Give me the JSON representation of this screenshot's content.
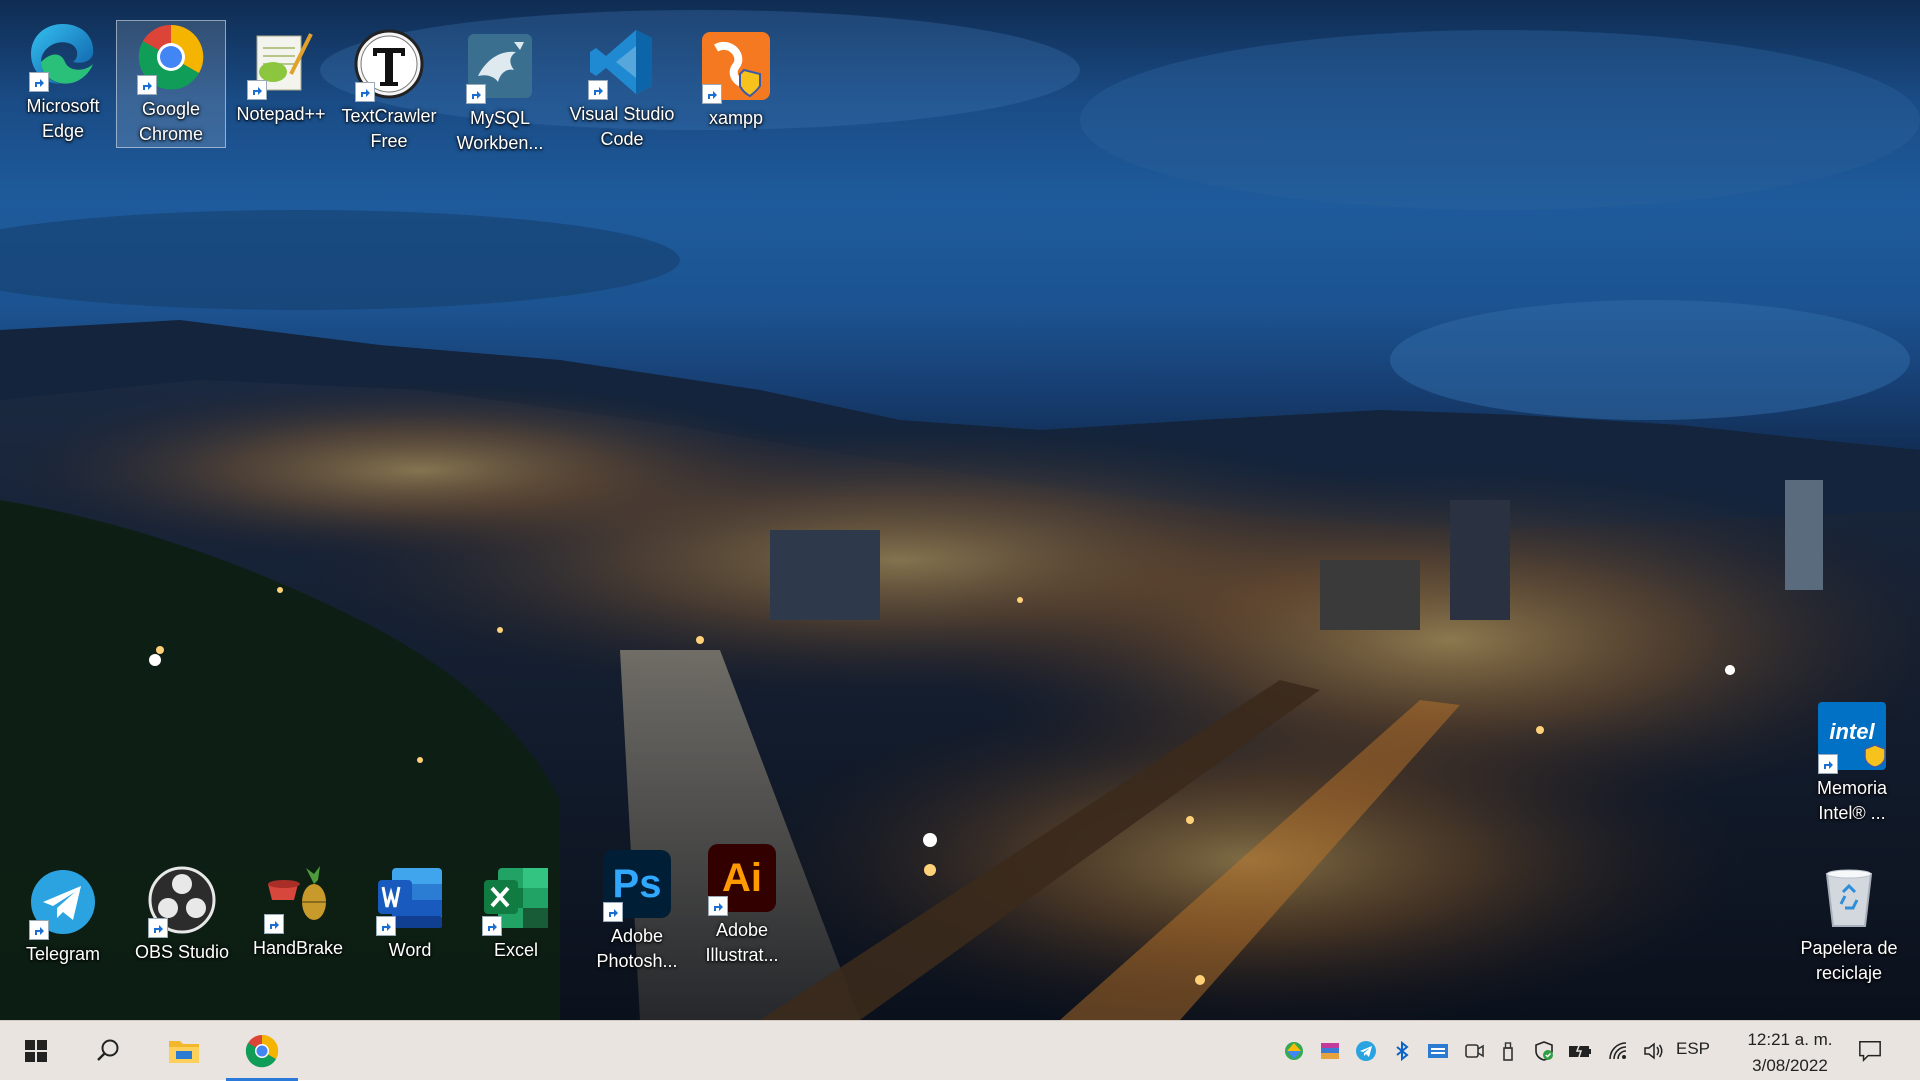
{
  "desktop": {
    "icons": [
      {
        "label": "Microsoft Edge",
        "icon": "edge-icon"
      },
      {
        "label": "Google Chrome",
        "icon": "chrome-icon",
        "selected": true
      },
      {
        "label": "Notepad++",
        "icon": "notepadpp-icon"
      },
      {
        "label": "TextCrawler Free",
        "icon": "textcrawler-icon"
      },
      {
        "label": "MySQL Workben...",
        "icon": "mysql-workbench-icon"
      },
      {
        "label": "Visual Studio Code",
        "icon": "vscode-icon"
      },
      {
        "label": "xampp",
        "icon": "xampp-icon"
      },
      {
        "label": "Telegram",
        "icon": "telegram-icon"
      },
      {
        "label": "OBS Studio",
        "icon": "obs-icon"
      },
      {
        "label": "HandBrake",
        "icon": "handbrake-icon"
      },
      {
        "label": "Word",
        "icon": "word-icon"
      },
      {
        "label": "Excel",
        "icon": "excel-icon"
      },
      {
        "label": "Adobe Photosh...",
        "icon": "photoshop-icon",
        "glyph_text": "Ps"
      },
      {
        "label": "Adobe Illustrat...",
        "icon": "illustrator-icon",
        "glyph_text": "Ai"
      },
      {
        "label": "Memoria Intel® ...",
        "icon": "intel-icon",
        "glyph_text": "intel"
      },
      {
        "label": "Papelera de reciclaje",
        "icon": "recycle-bin-icon"
      }
    ]
  },
  "taskbar": {
    "buttons": [
      "start-icon",
      "search-icon",
      "file-explorer-icon",
      "chrome-icon"
    ],
    "active": "chrome-icon",
    "tray": [
      "google-drive-icon",
      "winrar-icon",
      "telegram-icon",
      "bluetooth-icon",
      "keyboard-icon",
      "meet-now-icon",
      "usb-icon",
      "security-icon",
      "battery-icon",
      "wifi-icon",
      "volume-icon"
    ],
    "language": "ESP",
    "time": "12:21 a. m.",
    "date": "3/08/2022",
    "notifications_icon": "notification-icon"
  }
}
